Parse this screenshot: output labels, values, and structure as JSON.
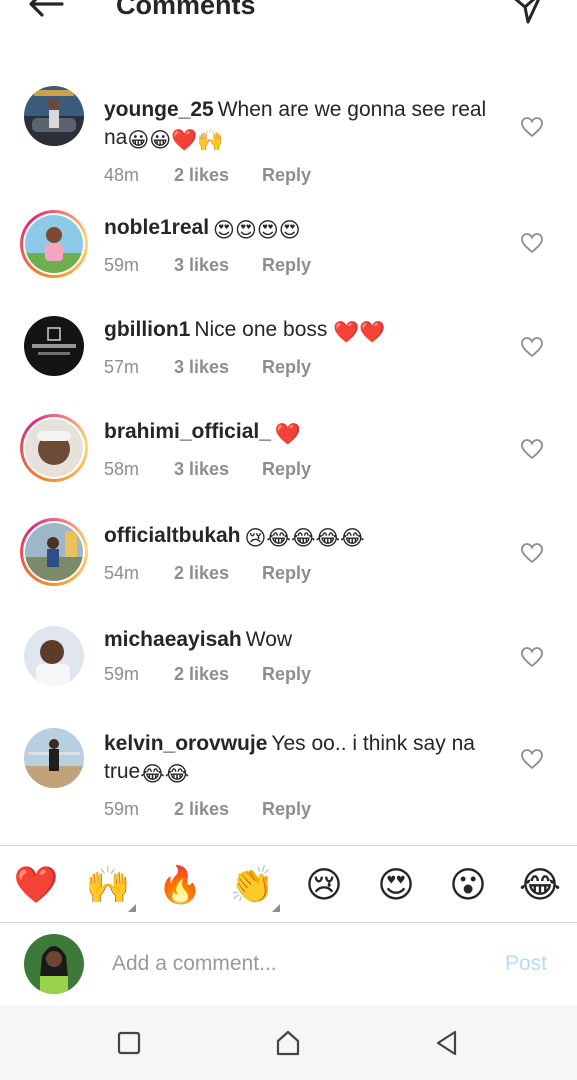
{
  "header": {
    "title": "Comments",
    "back_icon": "arrow-left-icon",
    "send_icon": "direct-send-icon"
  },
  "comments": [
    {
      "username": "younge_25",
      "text": "When are we gonna see real na",
      "emoji": "😀😀❤️🙌",
      "time": "48m",
      "likes": "2 likes",
      "reply": "Reply",
      "ring": false
    },
    {
      "username": "noble1real",
      "text": "",
      "emoji": "😍😍😍😍",
      "time": "59m",
      "likes": "3 likes",
      "reply": "Reply",
      "ring": true
    },
    {
      "username": "gbillion1",
      "text": "Nice one boss",
      "emoji": "❤️❤️",
      "time": "57m",
      "likes": "3 likes",
      "reply": "Reply",
      "ring": false
    },
    {
      "username": "brahimi_official_",
      "text": "",
      "emoji": "❤️",
      "time": "58m",
      "likes": "3 likes",
      "reply": "Reply",
      "ring": true
    },
    {
      "username": "officialtbukah",
      "text": "",
      "emoji": "😢😂😂😂😂",
      "time": "54m",
      "likes": "2 likes",
      "reply": "Reply",
      "ring": true
    },
    {
      "username": "michaeayisah",
      "text": "Wow",
      "emoji": "",
      "time": "59m",
      "likes": "2 likes",
      "reply": "Reply",
      "ring": false
    },
    {
      "username": "kelvin_orovwuje",
      "text": "Yes oo.. i think say na true",
      "emoji": "😂😂",
      "time": "59m",
      "likes": "2 likes",
      "reply": "Reply",
      "ring": false
    }
  ],
  "quick_emojis": [
    "❤️",
    "🙌",
    "🔥",
    "👏",
    "😢",
    "😍",
    "😮",
    "😂"
  ],
  "add_comment": {
    "placeholder": "Add a comment...",
    "post_label": "Post"
  },
  "colors": {
    "text": "#262626",
    "meta": "#8e8e8e",
    "post_disabled": "#b3dbff",
    "heart_red": "#ed4956"
  }
}
